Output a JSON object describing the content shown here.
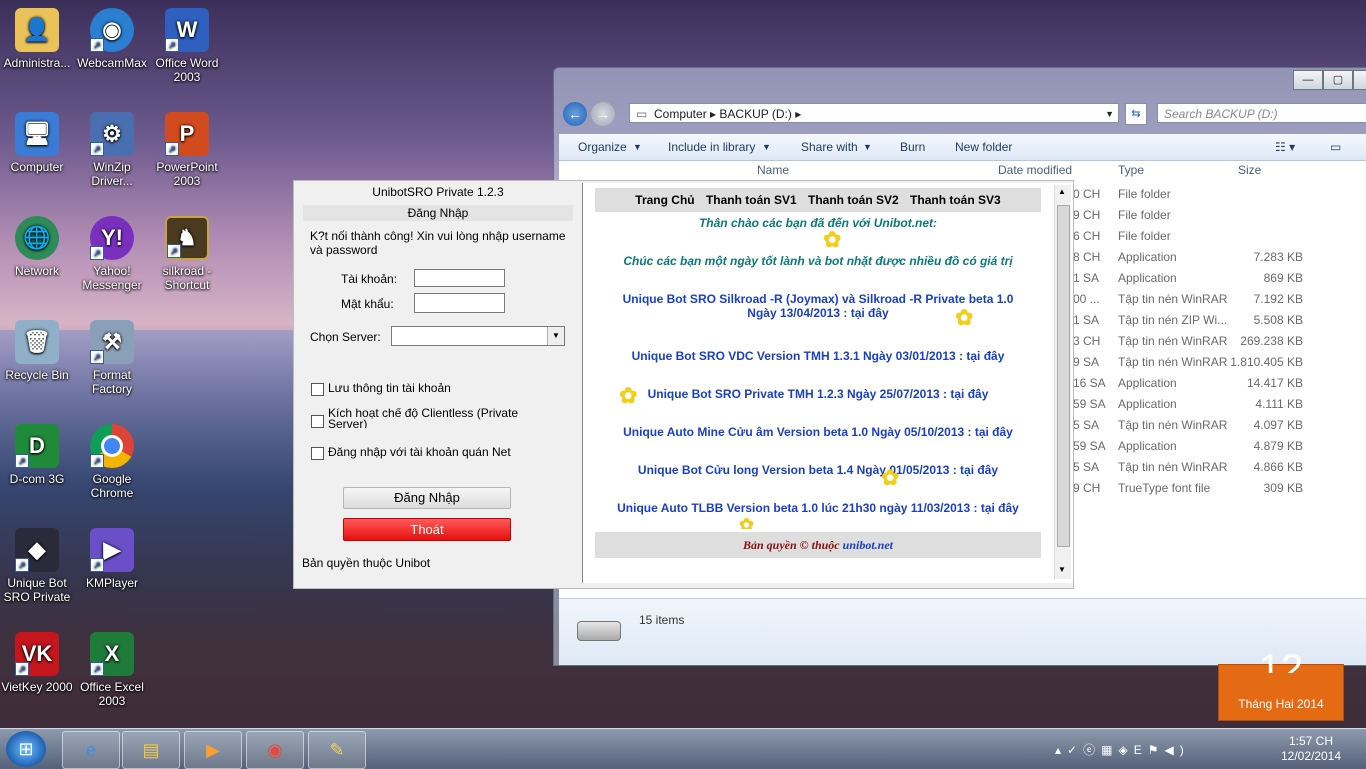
{
  "desktop": {
    "icons": [
      {
        "label": "Administra...",
        "icon": "user-folder-icon"
      },
      {
        "label": "WebcamMax",
        "icon": "webcam-icon"
      },
      {
        "label": "Office Word 2003",
        "icon": "word-icon"
      },
      {
        "label": "Computer",
        "icon": "computer-icon"
      },
      {
        "label": "WinZip Driver...",
        "icon": "winzip-icon"
      },
      {
        "label": "PowerPoint 2003",
        "icon": "powerpoint-icon"
      },
      {
        "label": "Network",
        "icon": "network-icon"
      },
      {
        "label": "Yahoo! Messenger",
        "icon": "yahoo-messenger-icon"
      },
      {
        "label": "silkroad - Shortcut",
        "icon": "silkroad-icon"
      },
      {
        "label": "Recycle Bin",
        "icon": "recycle-bin-icon"
      },
      {
        "label": "Format Factory",
        "icon": "format-factory-icon"
      },
      {
        "label": "D-com 3G",
        "icon": "dcom-icon"
      },
      {
        "label": "Google Chrome",
        "icon": "chrome-icon"
      },
      {
        "label": "Unique Bot SRO Private",
        "icon": "unique-bot-icon"
      },
      {
        "label": "KMPlayer",
        "icon": "kmplayer-icon"
      },
      {
        "label": "VietKey 2000",
        "icon": "vietkey-icon"
      },
      {
        "label": "Office Excel 2003",
        "icon": "excel-icon"
      }
    ]
  },
  "explorer": {
    "breadcrumb": [
      "Computer",
      "BACKUP (D:)"
    ],
    "search_placeholder": "Search BACKUP (D:)",
    "toolbar": {
      "organize": "Organize",
      "include": "Include in library",
      "share": "Share with",
      "burn": "Burn",
      "new_folder": "New folder"
    },
    "columns": {
      "name": "Name",
      "date": "Date modified",
      "type": "Type",
      "size": "Size"
    },
    "rows": [
      {
        "date": "0 CH",
        "type": "File folder",
        "size": ""
      },
      {
        "date": "9 CH",
        "type": "File folder",
        "size": ""
      },
      {
        "date": "6 CH",
        "type": "File folder",
        "size": ""
      },
      {
        "date": "8 CH",
        "type": "Application",
        "size": "7.283 KB"
      },
      {
        "date": "1 SA",
        "type": "Application",
        "size": "869 KB"
      },
      {
        "date": "00 ...",
        "type": "Tập tin nén WinRAR",
        "size": "7.192 KB"
      },
      {
        "date": "1 SA",
        "type": "Tập tin nén ZIP Wi...",
        "size": "5.508 KB"
      },
      {
        "date": "3 CH",
        "type": "Tập tin nén WinRAR",
        "size": "269.238 KB"
      },
      {
        "date": "9 SA",
        "type": "Tập tin nén WinRAR",
        "size": "1.810.405 KB"
      },
      {
        "date": "16 SA",
        "type": "Application",
        "size": "14.417 KB"
      },
      {
        "date": "59 SA",
        "type": "Application",
        "size": "4.111 KB"
      },
      {
        "date": "5 SA",
        "type": "Tập tin nén WinRAR",
        "size": "4.097 KB"
      },
      {
        "date": "59 SA",
        "type": "Application",
        "size": "4.879 KB"
      },
      {
        "date": "5 SA",
        "type": "Tập tin nén WinRAR",
        "size": "4.866 KB"
      },
      {
        "date": "9 CH",
        "type": "TrueType font file",
        "size": "309 KB"
      }
    ],
    "status": "15 items"
  },
  "calendar_gadget": {
    "day": "12",
    "month": "Tháng Hai 2014"
  },
  "unibot": {
    "title": "UnibotSRO Private 1.2.3",
    "login_header": "Đăng Nhập",
    "message": "K?t nối thành công! Xin vui lòng nhập username và password",
    "username_label": "Tài khoản:",
    "password_label": "Mật khẩu:",
    "server_label": "Chọn Server:",
    "chk_save": "Lưu thông tin tài khoản",
    "chk_clientless": "Kích hoạt chế độ Clientless (Private Server)",
    "chk_net": "Đăng nhập với tài khoản quán Net",
    "login_button": "Đăng Nhập",
    "exit_button": "Thoát",
    "copyright": "Bản quyền thuộc Unibot",
    "web": {
      "nav": [
        "Trang Chủ",
        "Thanh toán SV1",
        "Thanh toán SV2",
        "Thanh toán SV3"
      ],
      "greeting": "Thân chào các bạn đã đến với Unibot.net:",
      "wish": "Chúc các bạn một ngày tốt lành và bot nhặt được nhiều đồ có giá trị",
      "items": [
        {
          "text": "Unique Bot SRO Silkroad -R (Joymax) và Silkroad -R Private beta 1.0",
          "text2": "Ngày 13/04/2013 :",
          "link": "tại đây"
        },
        {
          "text": "Unique Bot SRO VDC Version TMH 1.3.1 Ngày 03/01/2013 :",
          "link": "tại đây"
        },
        {
          "text": "Unique Bot SRO Private TMH 1.2.3 Ngày 25/07/2013 :",
          "link": "tại đây"
        },
        {
          "text": "Unique Auto Mine Cửu âm Version beta 1.0 Ngày 05/10/2013 :",
          "link": "tại đây"
        },
        {
          "text": "Unique Bot Cửu long Version beta 1.4 Ngày 01/05/2013 :",
          "link": "tại đây"
        },
        {
          "text": "Unique Auto TLBB Version beta 1.0 lúc 21h30 ngày 11/03/2013 :",
          "link": "tại đây"
        }
      ],
      "footer": "Bản quyền © thuộc",
      "footer_link": "unibot.net"
    }
  },
  "taskbar": {
    "buttons": [
      "ie-icon",
      "explorer-folder-icon",
      "media-player-icon",
      "chrome-icon",
      "paint-icon"
    ],
    "clock_time": "1:57 CH",
    "clock_date": "12/02/2014"
  }
}
